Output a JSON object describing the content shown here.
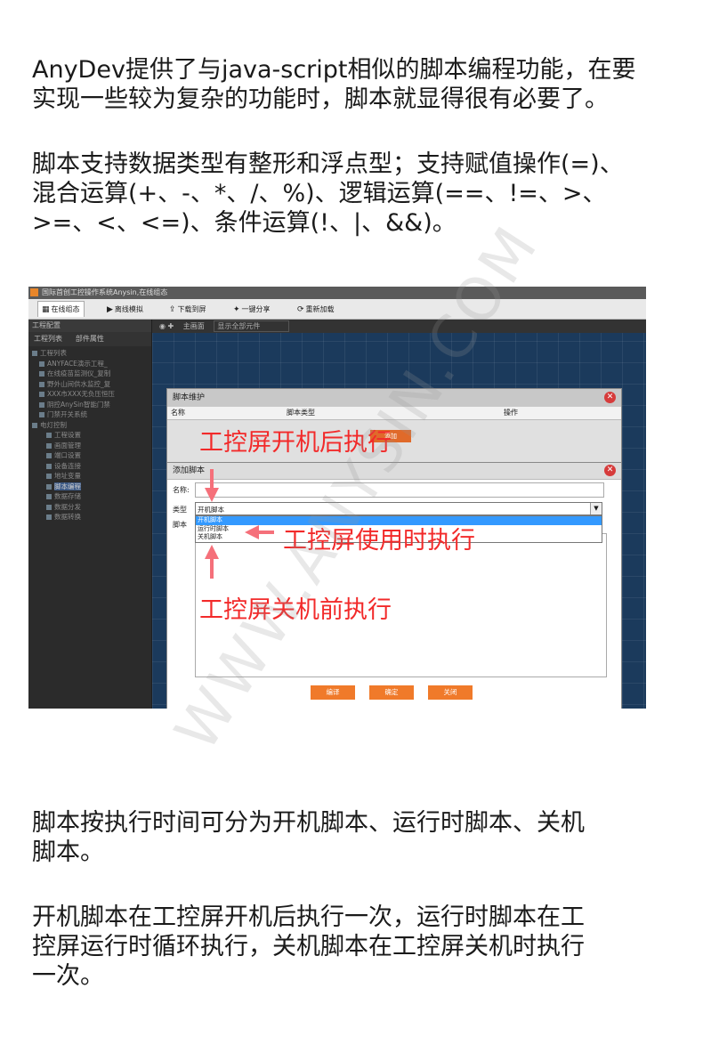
{
  "intro": {
    "p1": "AnyDev提供了与java-script相似的脚本编程功能，在要\n实现一些较为复杂的功能时，脚本就显得很有必要了。",
    "p2": "脚本支持数据类型有整形和浮点型；支持赋值操作(=)、\n混合运算(+、-、*、/、%)、逻辑运算(==、!=、>、\n>=、<、<=)、条件运算(!、|、&&)。"
  },
  "screenshot": {
    "window_title": "国际首创工控操作系统Anysin,在线组态",
    "toolbar": [
      {
        "label": "在线组态",
        "icon": "grid-icon",
        "glyph": "▦"
      },
      {
        "label": "离线模拟",
        "icon": "play-icon",
        "glyph": "▶"
      },
      {
        "label": "下载到屏",
        "icon": "export-icon",
        "glyph": "⇪"
      },
      {
        "label": "一键分享",
        "icon": "share-icon",
        "glyph": "✦"
      },
      {
        "label": "重新加载",
        "icon": "reload-icon",
        "glyph": "⟳"
      }
    ],
    "left_panel": {
      "title": "工程配置",
      "tabs": [
        "工程列表",
        "部件属性"
      ],
      "items": [
        {
          "label": "工程列表",
          "level": 0
        },
        {
          "label": "ANYFACE演示工程_",
          "level": 1
        },
        {
          "label": "在线疫苗监测仪_复制",
          "level": 1
        },
        {
          "label": "野外山间供水监控_复",
          "level": 1
        },
        {
          "label": "XXX市XXX无负压恒压",
          "level": 1
        },
        {
          "label": "阴控AnySin智能门禁",
          "level": 1
        },
        {
          "label": "门禁开关系统",
          "level": 1
        },
        {
          "label": "电灯控制",
          "level": 0
        },
        {
          "label": "工程设置",
          "level": 2
        },
        {
          "label": "画面管理",
          "level": 2
        },
        {
          "label": "端口设置",
          "level": 2
        },
        {
          "label": "设备连接",
          "level": 2
        },
        {
          "label": "地址变量",
          "level": 2
        },
        {
          "label": "脚本编程",
          "level": 2,
          "selected": true
        },
        {
          "label": "数据存储",
          "level": 2
        },
        {
          "label": "数据分发",
          "level": 2
        },
        {
          "label": "数据转换",
          "level": 2
        }
      ]
    },
    "canvas_header": {
      "screen_label": "主画面",
      "combo_value": "显示全部元件"
    },
    "dialog_script_maintenance": {
      "title": "脚本维护",
      "columns": [
        "名称",
        "脚本类型",
        "操作"
      ],
      "add_button": "添加"
    },
    "dialog_add_script": {
      "title": "添加脚本",
      "name_label": "名称:",
      "type_label": "类型",
      "script_label": "脚本",
      "selected_type": "开机脚本",
      "type_options": [
        "开机脚本",
        "运行时脚本",
        "关机脚本"
      ],
      "buttons": [
        "编译",
        "确定",
        "关闭"
      ]
    }
  },
  "annotations": {
    "boot": "工控屏开机后执行",
    "runtime": "工控屏使用时执行",
    "shutdown": "工控屏关机前执行",
    "color": "#f22a2a"
  },
  "outro": {
    "p3": "脚本按执行时间可分为开机脚本、运行时脚本、关机\n脚本。",
    "p4": "开机脚本在工控屏开机后执行一次，运行时脚本在工\n控屏运行时循环执行，关机脚本在工控屏关机时执行\n一次。"
  },
  "watermark": "WWW.ANYSIN.COM"
}
